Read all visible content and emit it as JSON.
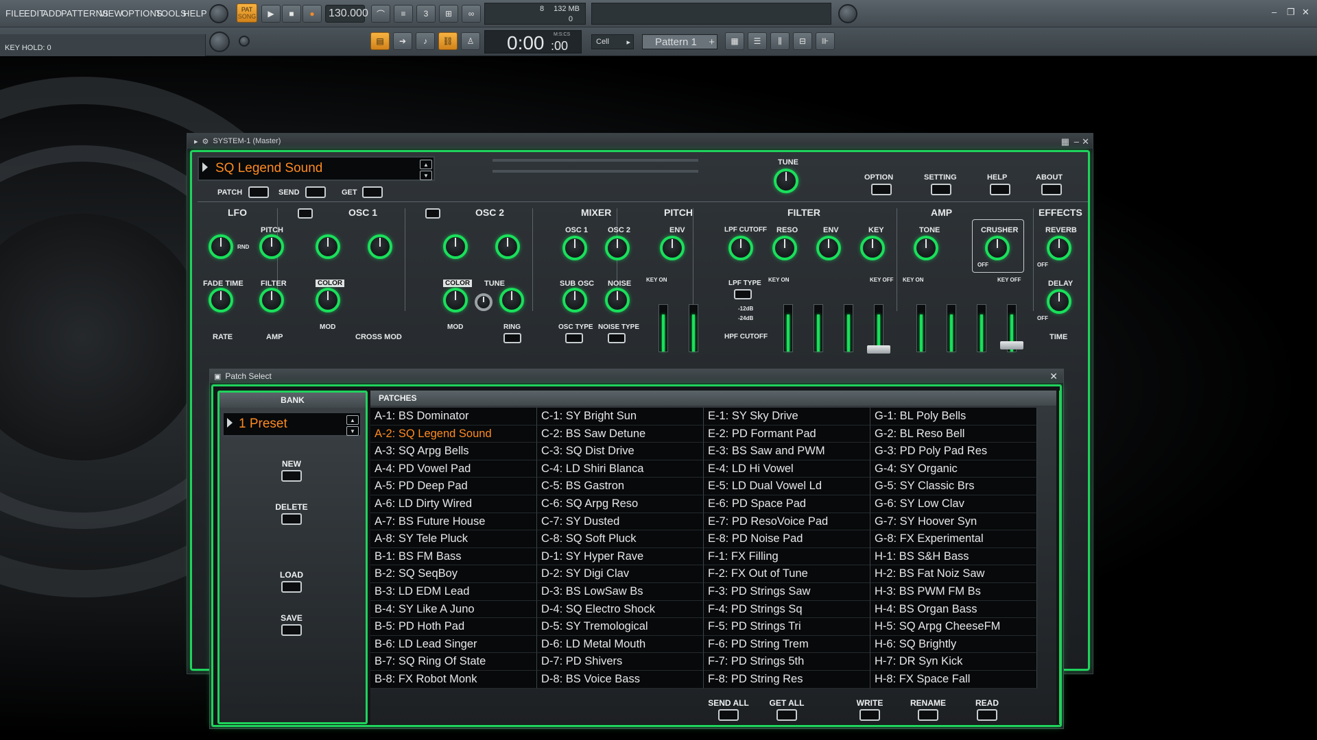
{
  "fl": {
    "menu": [
      "FILE",
      "EDIT",
      "ADD",
      "PATTERNS",
      "VIEW",
      "OPTIONS",
      "TOOLS",
      "HELP"
    ],
    "pat_label": "PAT",
    "song_label": "SONG",
    "tempo": "130.000",
    "cpu_value": "8",
    "mem_value": "132 MB",
    "poly_value": "0",
    "key_hold": "KEY HOLD: 0",
    "time": "0:00",
    "time_small": ":00",
    "time_unit": "M:S:CS",
    "snap": "Cell",
    "pattern": "Pattern 1"
  },
  "system1": {
    "title": "SYSTEM-1 (Master)",
    "patch_name": "SQ Legend Sound",
    "patch_btn": "PATCH",
    "send_btn": "SEND",
    "get_btn": "GET",
    "tune": "TUNE",
    "option": "OPTION",
    "setting": "SETTING",
    "help": "HELP",
    "about": "ABOUT",
    "sections": {
      "lfo": "LFO",
      "osc1": "OSC 1",
      "osc2": "OSC 2",
      "mixer": "MIXER",
      "pitch": "PITCH",
      "filter": "FILTER",
      "amp": "AMP",
      "effects": "EFFECTS"
    },
    "labels": {
      "lfo_pitch": "PITCH",
      "fade_time": "FADE TIME",
      "lfo_filter": "FILTER",
      "rate": "RATE",
      "lfo_amp": "AMP",
      "rnd": "RND",
      "color1": "COLOR",
      "mod1": "MOD",
      "cross_mod": "CROSS MOD",
      "color2": "COLOR",
      "tune2": "TUNE",
      "mod2": "MOD",
      "ring": "RING",
      "mix_osc1": "OSC 1",
      "mix_osc2": "OSC 2",
      "sub_osc": "SUB OSC",
      "noise": "NOISE",
      "osc_type": "OSC TYPE",
      "noise_type": "NOISE TYPE",
      "pitch_env": "ENV",
      "key_on_p": "KEY ON",
      "lpf_cutoff": "LPF CUTOFF",
      "reso": "RESO",
      "filter_env": "ENV",
      "key": "KEY",
      "lpf_type": "LPF TYPE",
      "db12": "-12dB",
      "db24": "-24dB",
      "hpf_cutoff": "HPF CUTOFF",
      "key_on_f": "KEY ON",
      "key_off_f": "KEY OFF",
      "tone": "TONE",
      "crusher": "CRUSHER",
      "key_on_a": "KEY ON",
      "key_off_a": "KEY OFF",
      "reverb": "REVERB",
      "delay": "DELAY",
      "time": "TIME",
      "off1": "OFF",
      "off2": "OFF",
      "off3": "OFF"
    }
  },
  "patch_select": {
    "title": "Patch Select",
    "bank_header": "BANK",
    "bank_name": "1 Preset",
    "patches_header": "PATCHES",
    "new": "NEW",
    "delete": "DELETE",
    "load": "LOAD",
    "save": "SAVE",
    "send_all": "SEND ALL",
    "get_all": "GET ALL",
    "write": "WRITE",
    "rename": "RENAME",
    "read": "READ",
    "selected": "A-2: SQ Legend Sound",
    "columns": [
      [
        "A-1: BS Dominator",
        "A-2: SQ Legend Sound",
        "A-3: SQ Arpg Bells",
        "A-4: PD Vowel Pad",
        "A-5: PD Deep Pad",
        "A-6: LD Dirty Wired",
        "A-7: BS Future House",
        "A-8: SY Tele Pluck",
        "B-1: BS FM Bass",
        "B-2: SQ SeqBoy",
        "B-3: LD EDM Lead",
        "B-4: SY Like A Juno",
        "B-5: PD Hoth Pad",
        "B-6: LD Lead Singer",
        "B-7: SQ Ring Of State",
        "B-8: FX Robot Monk"
      ],
      [
        "C-1: SY Bright Sun",
        "C-2: BS Saw Detune",
        "C-3: SQ Dist Drive",
        "C-4: LD Shiri Blanca",
        "C-5: BS Gastron",
        "C-6: SQ Arpg Reso",
        "C-7: SY Dusted",
        "C-8: SQ Soft Pluck",
        "D-1: SY Hyper Rave",
        "D-2: SY Digi Clav",
        "D-3: BS LowSaw Bs",
        "D-4: SQ Electro Shock",
        "D-5: SY Tremological",
        "D-6: LD Metal Mouth",
        "D-7: PD Shivers",
        "D-8: BS Voice Bass"
      ],
      [
        "E-1: SY Sky Drive",
        "E-2: PD Formant Pad",
        "E-3: BS Saw and PWM",
        "E-4: LD Hi Vowel",
        "E-5: LD Dual Vowel Ld",
        "E-6: PD Space Pad",
        "E-7: PD ResoVoice Pad",
        "E-8: PD Noise Pad",
        "F-1: FX Filling",
        "F-2: FX Out of Tune",
        "F-3: PD Strings Saw",
        "F-4: PD Strings Sq",
        "F-5: PD Strings Tri",
        "F-6: PD String Trem",
        "F-7: PD Strings 5th",
        "F-8: PD String Res"
      ],
      [
        "G-1: BL Poly Bells",
        "G-2: BL Reso Bell",
        "G-3: PD Poly Pad Res",
        "G-4: SY Organic",
        "G-5: SY Classic Brs",
        "G-6: SY Low Clav",
        "G-7: SY Hoover Syn",
        "G-8: FX Experimental",
        "H-1: BS S&H Bass",
        "H-2: BS Fat Noiz Saw",
        "H-3: BS PWM FM Bs",
        "H-4: BS Organ Bass",
        "H-5: SQ Arpg CheeseFM",
        "H-6: SQ Brightly",
        "H-7: DR Syn Kick",
        "H-8: FX Space Fall"
      ]
    ]
  }
}
